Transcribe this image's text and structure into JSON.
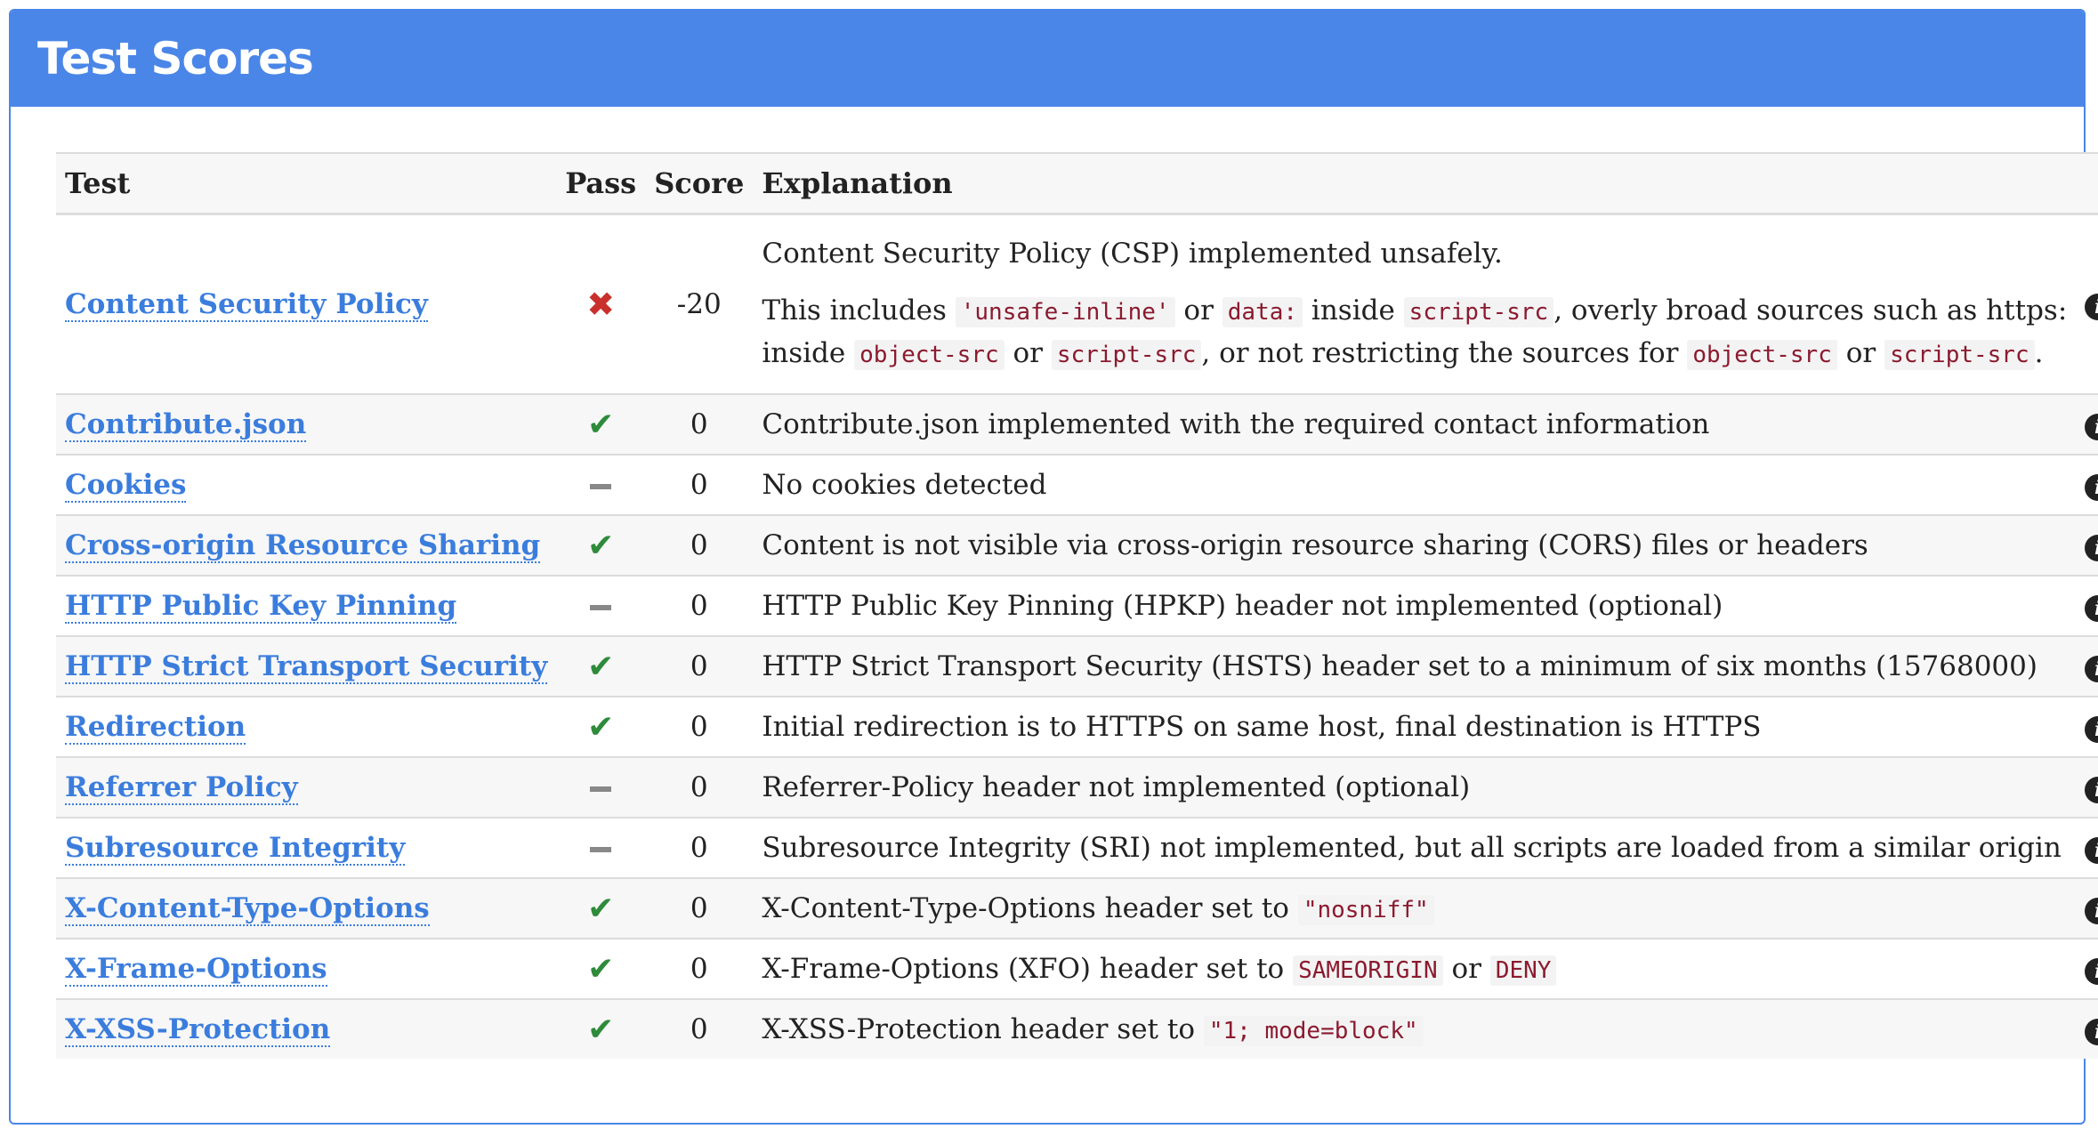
{
  "title": "Test Scores",
  "headers": {
    "test": "Test",
    "pass": "Pass",
    "score": "Score",
    "explanation": "Explanation"
  },
  "rows": [
    {
      "test": "Content Security Policy",
      "status": "fail",
      "score": "-20",
      "explanation": "Content Security Policy (CSP) implemented unsafely.",
      "detail": {
        "t1": "This includes",
        "c1": "'unsafe-inline'",
        "t2": "or",
        "c2": "data:",
        "t3": "inside",
        "c3": "script-src",
        "t4": ", overly broad sources such as https:",
        "t5": "inside",
        "c4": "object-src",
        "t6": "or",
        "c5": "script-src",
        "t7": ", or not restricting the sources for",
        "c6": "object-src",
        "t8": "or",
        "c7": "script-src",
        "t9": "."
      }
    },
    {
      "test": "Contribute.json",
      "status": "pass",
      "score": "0",
      "explanation": "Contribute.json implemented with the required contact information"
    },
    {
      "test": "Cookies",
      "status": "neutral",
      "score": "0",
      "explanation": "No cookies detected"
    },
    {
      "test": "Cross-origin Resource Sharing",
      "status": "pass",
      "score": "0",
      "explanation": "Content is not visible via cross-origin resource sharing (CORS) files or headers"
    },
    {
      "test": "HTTP Public Key Pinning",
      "status": "neutral",
      "score": "0",
      "explanation": "HTTP Public Key Pinning (HPKP) header not implemented (optional)"
    },
    {
      "test": "HTTP Strict Transport Security",
      "status": "pass",
      "score": "0",
      "explanation": "HTTP Strict Transport Security (HSTS) header set to a minimum of six months (15768000)"
    },
    {
      "test": "Redirection",
      "status": "pass",
      "score": "0",
      "explanation": "Initial redirection is to HTTPS on same host, final destination is HTTPS"
    },
    {
      "test": "Referrer Policy",
      "status": "neutral",
      "score": "0",
      "explanation": "Referrer-Policy header not implemented (optional)"
    },
    {
      "test": "Subresource Integrity",
      "status": "neutral",
      "score": "0",
      "explanation": "Subresource Integrity (SRI) not implemented, but all scripts are loaded from a similar origin"
    },
    {
      "test": "X-Content-Type-Options",
      "status": "pass",
      "score": "0",
      "explanation": "X-Content-Type-Options header set to",
      "code1": "\"nosniff\""
    },
    {
      "test": "X-Frame-Options",
      "status": "pass",
      "score": "0",
      "explanation": "X-Frame-Options (XFO) header set to",
      "code1": "SAMEORIGIN",
      "mid": "or",
      "code2": "DENY"
    },
    {
      "test": "X-XSS-Protection",
      "status": "pass",
      "score": "0",
      "explanation": "X-XSS-Protection header set to",
      "code1": "\"1; mode=block\""
    }
  ],
  "colors": {
    "accent": "#4a86e8",
    "link": "#3b7ddd",
    "pass": "#2e8b3a",
    "fail": "#c9302c",
    "neutral": "#888888",
    "code": "#8b1a2f"
  },
  "icons": {
    "pass": "check-icon",
    "fail": "x-icon",
    "neutral": "dash-icon",
    "info": "info-icon"
  }
}
